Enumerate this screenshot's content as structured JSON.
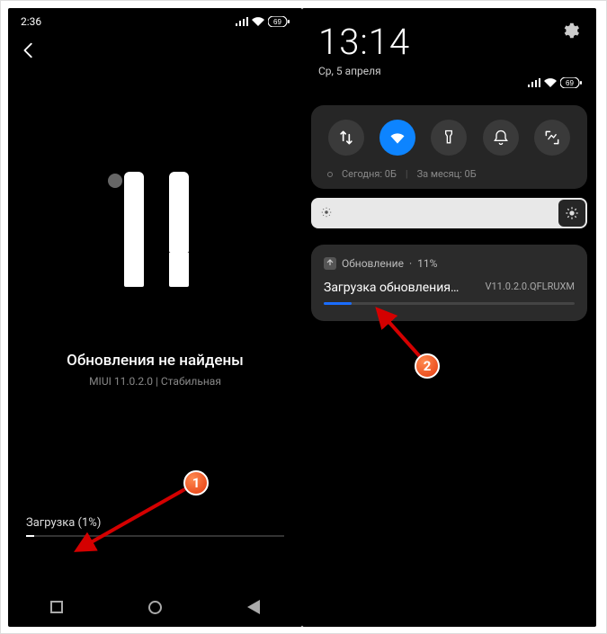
{
  "left": {
    "statusbar": {
      "time": "2:36",
      "battery": "69"
    },
    "title": "Обновления не найдены",
    "subtitle": "MIUI 11.0.2.0 | Стабильная",
    "download_label": "Загрузка (1%)",
    "download_percent": 1
  },
  "right": {
    "clock": "13:14",
    "date": "Ср, 5 апреля",
    "statusbar": {
      "battery": "69"
    },
    "qs": {
      "tiles": [
        "data",
        "wifi",
        "flashlight",
        "dnd",
        "screenshot"
      ],
      "active_index": 1,
      "data_today_label": "Сегодня: 0Б",
      "data_month_label": "За месяц: 0Б"
    },
    "notification": {
      "app": "Обновление",
      "percent_label": "11%",
      "title": "Загрузка обновления…",
      "version": "V11.0.2.0.QFLRUXM",
      "percent": 11
    }
  },
  "annotations": {
    "badge1": "1",
    "badge2": "2"
  }
}
